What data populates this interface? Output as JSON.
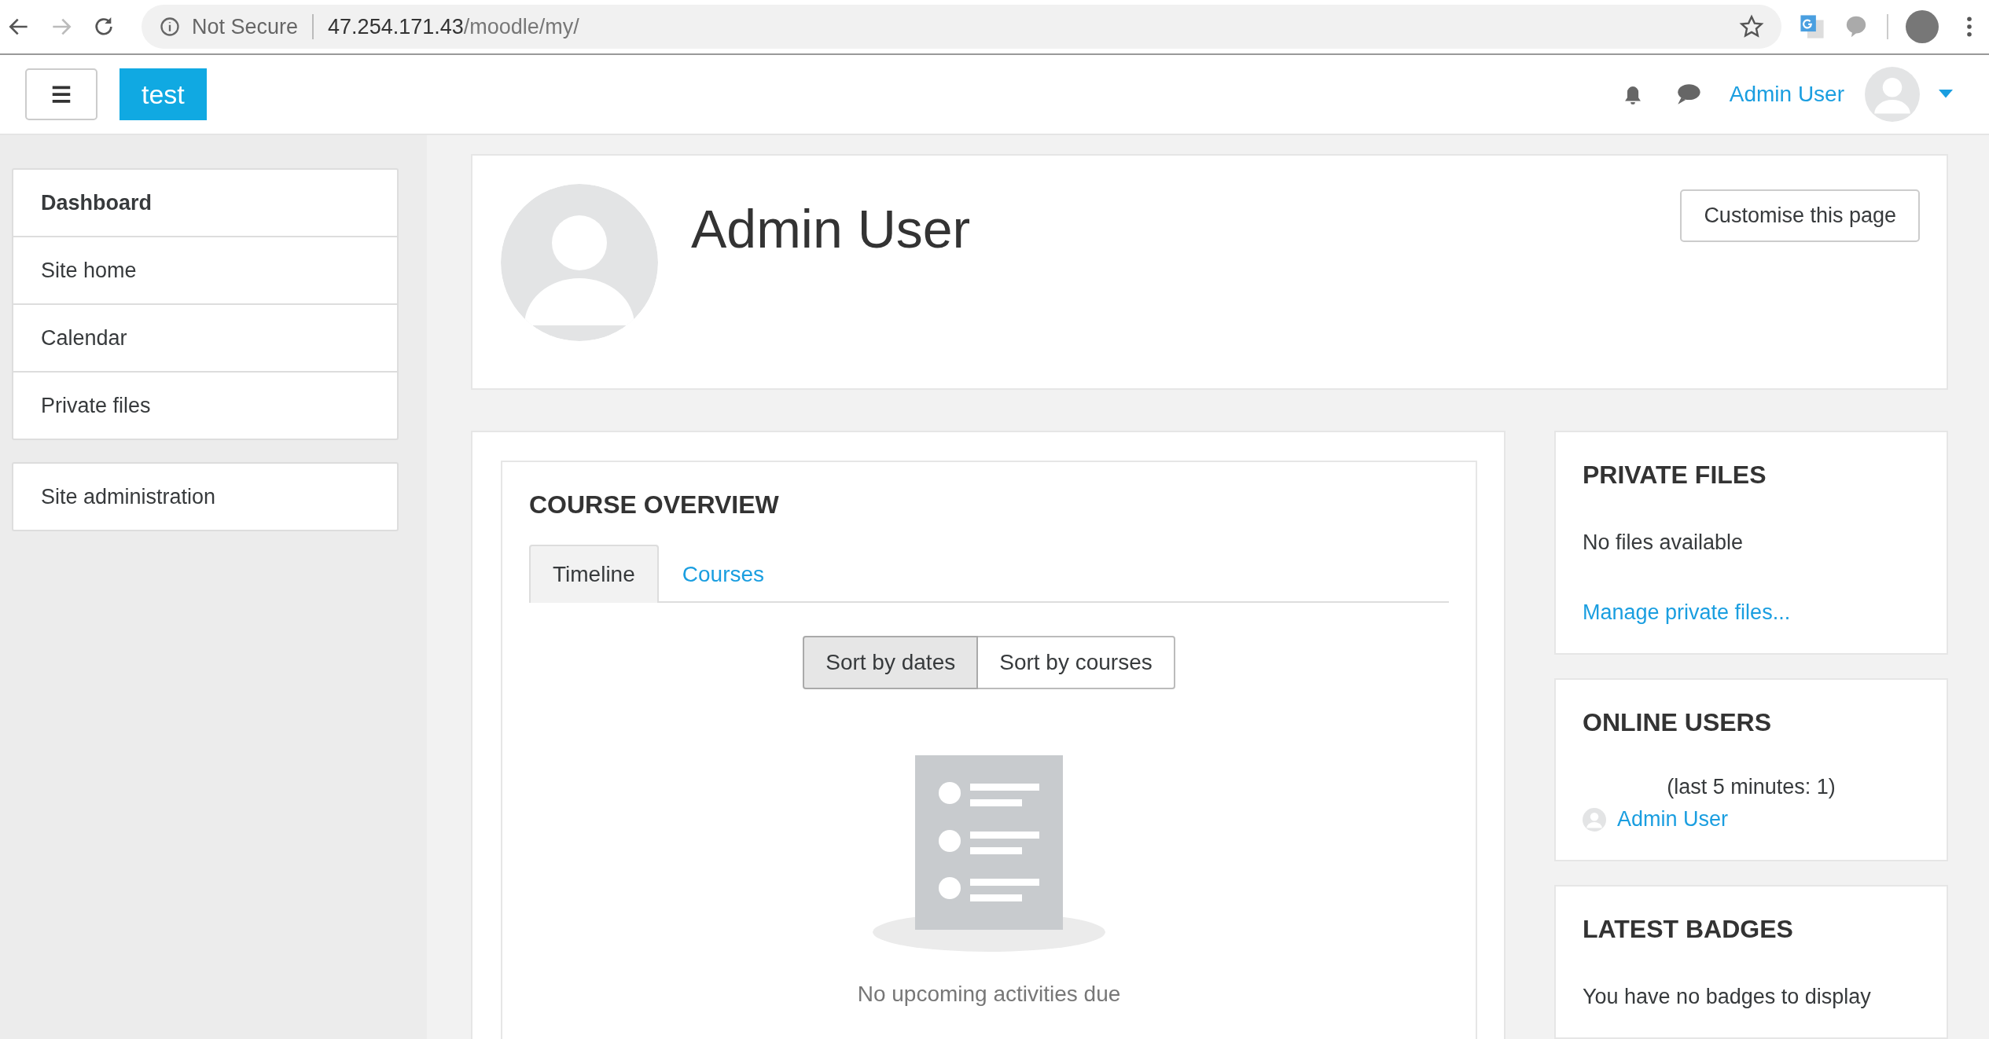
{
  "browser": {
    "security_label": "Not Secure",
    "url_host": "47.254.171.43",
    "url_path": "/moodle/my/"
  },
  "navbar": {
    "site_name": "test",
    "user_name": "Admin User"
  },
  "nav_drawer": {
    "groups": [
      [
        {
          "label": "Dashboard",
          "selected": true
        },
        {
          "label": "Site home",
          "selected": false
        },
        {
          "label": "Calendar",
          "selected": false
        },
        {
          "label": "Private files",
          "selected": false
        }
      ],
      [
        {
          "label": "Site administration",
          "selected": false
        }
      ]
    ]
  },
  "header": {
    "name": "Admin User",
    "customise_button": "Customise this page"
  },
  "course_overview": {
    "title": "COURSE OVERVIEW",
    "tabs": [
      {
        "label": "Timeline",
        "selected": true
      },
      {
        "label": "Courses",
        "selected": false
      }
    ],
    "sort_buttons": [
      {
        "label": "Sort by dates",
        "selected": true
      },
      {
        "label": "Sort by courses",
        "selected": false
      }
    ],
    "empty_message": "No upcoming activities due"
  },
  "blocks": [
    {
      "kind": "text_link",
      "title": "PRIVATE FILES",
      "message": "No files available",
      "link": "Manage private files..."
    },
    {
      "kind": "users",
      "title": "ONLINE USERS",
      "note": "(last 5 minutes: 1)",
      "users": [
        {
          "name": "Admin User"
        }
      ]
    },
    {
      "kind": "text",
      "title": "LATEST BADGES",
      "message": "You have no badges to display"
    }
  ]
}
